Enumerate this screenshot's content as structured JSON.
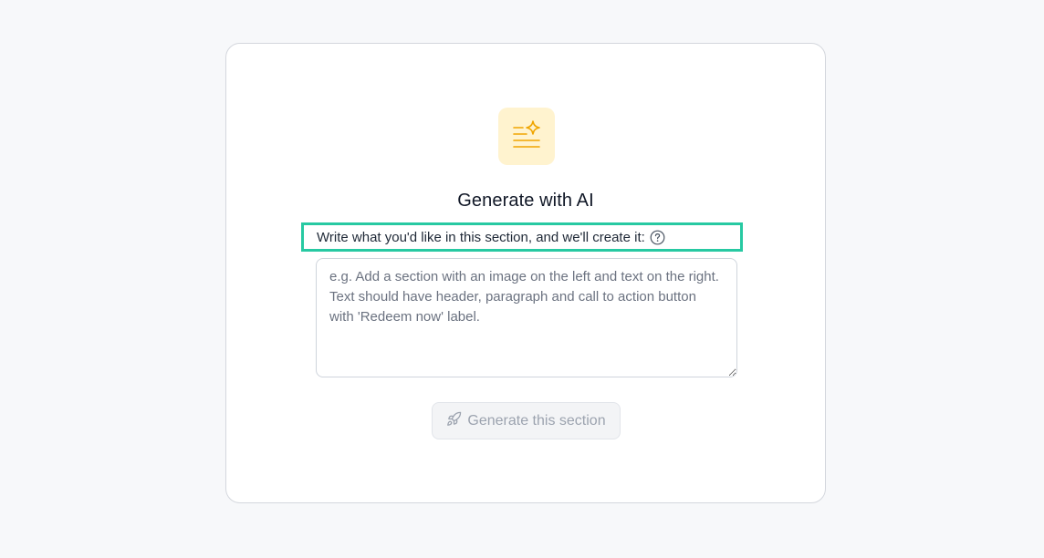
{
  "dialog": {
    "title": "Generate with AI",
    "prompt_label": "Write what you'd like in this section, and we'll create it:",
    "prompt_placeholder": "e.g. Add a section with an image on the left and text on the right. Text should have header, paragraph and call to action button with 'Redeem now' label.",
    "prompt_value": "",
    "generate_button_label": "Generate this section",
    "generate_button_disabled": true
  },
  "icons": {
    "badge": "text-sparkle-icon",
    "help": "question-circle-icon",
    "button": "rocket-icon"
  },
  "colors": {
    "page_background": "#f7f8fa",
    "badge_background": "#fff3cf",
    "badge_icon": "#f0a500",
    "highlight_border": "#27c9a2",
    "button_text_disabled": "#9ca3af"
  }
}
